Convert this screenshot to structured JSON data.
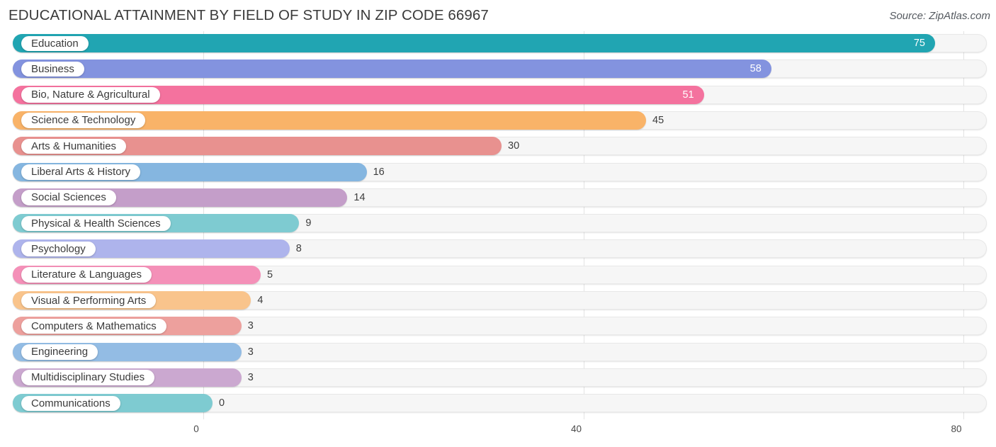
{
  "header": {
    "title": "EDUCATIONAL ATTAINMENT BY FIELD OF STUDY IN ZIP CODE 66967",
    "source": "Source: ZipAtlas.com"
  },
  "chart_data": {
    "type": "bar",
    "orientation": "horizontal",
    "title": "EDUCATIONAL ATTAINMENT BY FIELD OF STUDY IN ZIP CODE 66967",
    "subtitle": "Source: ZipAtlas.com",
    "xlabel": "",
    "ylabel": "",
    "xlim": [
      0,
      80
    ],
    "xticks": [
      0,
      40,
      80
    ],
    "xtick_labels": [
      "0",
      "40",
      "80"
    ],
    "grid": true,
    "grid_axis": "x",
    "legend": false,
    "categories": [
      "Education",
      "Business",
      "Bio, Nature & Agricultural",
      "Science & Technology",
      "Arts & Humanities",
      "Liberal Arts & History",
      "Social Sciences",
      "Physical & Health Sciences",
      "Psychology",
      "Literature & Languages",
      "Visual & Performing Arts",
      "Computers & Mathematics",
      "Engineering",
      "Multidisciplinary Studies",
      "Communications"
    ],
    "values": [
      75,
      58,
      51,
      45,
      30,
      16,
      14,
      9,
      8,
      5,
      4,
      3,
      3,
      3,
      0
    ],
    "value_labels": [
      "75",
      "58",
      "51",
      "45",
      "30",
      "16",
      "14",
      "9",
      "8",
      "5",
      "4",
      "3",
      "3",
      "3",
      "0"
    ],
    "bar_colors": [
      "#21a5b2",
      "#8393df",
      "#f4729e",
      "#f9b368",
      "#e8918f",
      "#85b6e0",
      "#c49ec9",
      "#7ecbd1",
      "#aeb4ec",
      "#f490b8",
      "#f9c48c",
      "#eda09d",
      "#93bce4",
      "#cba8d0",
      "#7ecbd1"
    ],
    "label_inside": [
      true,
      true,
      true,
      false,
      false,
      false,
      false,
      false,
      false,
      false,
      false,
      false,
      false,
      false,
      false
    ]
  },
  "colors": {
    "track": "#f6f6f6",
    "gridline": "#e3e3e3",
    "text": "#3a3a3a",
    "value_inside": "#ffffff",
    "value_outside": "#3d3d3d"
  }
}
